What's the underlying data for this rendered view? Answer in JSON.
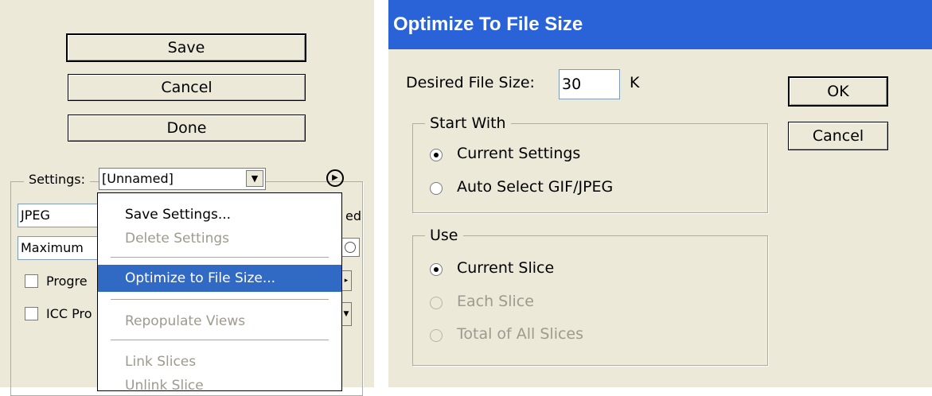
{
  "left_panel": {
    "buttons": {
      "save": "Save",
      "cancel": "Cancel",
      "done": "Done"
    },
    "settings": {
      "label": "Settings:",
      "value": "[Unnamed]"
    },
    "format_value": "JPEG",
    "quality_value": "Maximum",
    "checkboxes": {
      "progressive": "Progre",
      "icc_profile": "ICC Pro"
    },
    "partial_text": "ed",
    "menu": {
      "items": [
        {
          "label": "Save Settings...",
          "enabled": true
        },
        {
          "label": "Delete Settings",
          "enabled": false
        },
        {
          "label": "Optimize to File Size...",
          "enabled": true,
          "highlighted": true
        },
        {
          "label": "Repopulate Views",
          "enabled": false
        },
        {
          "label": "Link Slices",
          "enabled": false
        },
        {
          "label": "Unlink Slice",
          "enabled": false
        }
      ]
    }
  },
  "dialog": {
    "title": "Optimize To File Size",
    "desired_size_label": "Desired File Size:",
    "desired_size_value": "30",
    "unit": "K",
    "ok_label": "OK",
    "cancel_label": "Cancel",
    "start_with": {
      "legend": "Start With",
      "options": [
        {
          "label": "Current Settings",
          "checked": true,
          "enabled": true
        },
        {
          "label": "Auto Select GIF/JPEG",
          "checked": false,
          "enabled": true
        }
      ]
    },
    "use": {
      "legend": "Use",
      "options": [
        {
          "label": "Current Slice",
          "checked": true,
          "enabled": true
        },
        {
          "label": "Each Slice",
          "checked": false,
          "enabled": false
        },
        {
          "label": "Total of All Slices",
          "checked": false,
          "enabled": false
        }
      ]
    }
  },
  "colors": {
    "title_bar": "#2a62d8",
    "menu_highlight": "#316ac5",
    "panel_bg": "#ece9d8"
  }
}
